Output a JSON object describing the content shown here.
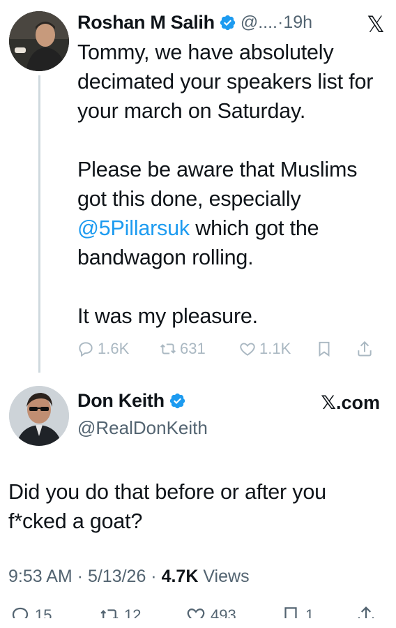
{
  "parent_tweet": {
    "author_name": "Roshan M Salih",
    "handle_time": "@....·19h",
    "x_icon_glyph": "𝕏",
    "paragraphs": [
      {
        "text": "Tommy, we have absolutely decimated your speakers list for your march on Saturday."
      },
      {
        "before": "Please be aware that Muslims got this done, especially ",
        "mention": "@5Pillarsuk",
        "after": " which got the bandwagon rolling."
      },
      {
        "text": "It was my pleasure."
      }
    ],
    "stats": {
      "replies": "1.6K",
      "reposts": "631",
      "likes": "1.1K"
    }
  },
  "main_tweet": {
    "author_name": "Don Keith",
    "handle": "@RealDonKeith",
    "source_label": "𝕏.com",
    "text": "Did you do that before or after you f*cked a goat?",
    "timestamp": "9:53 AM · 5/13/26 · ",
    "views_count": "4.7K",
    "views_label": " Views",
    "stats": {
      "replies": "15",
      "reposts": "12",
      "likes": "493",
      "bookmarks": "1"
    }
  },
  "icons": {
    "verified": "verified-badge-icon",
    "reply": "reply-icon",
    "repost": "repost-icon",
    "like": "heart-icon",
    "bookmark": "bookmark-icon",
    "share": "share-icon"
  },
  "colors": {
    "verified_blue": "#1d9bf0",
    "mention_blue": "#1d9bf0",
    "secondary_text": "#536471",
    "faded_action": "#aab8c2"
  }
}
